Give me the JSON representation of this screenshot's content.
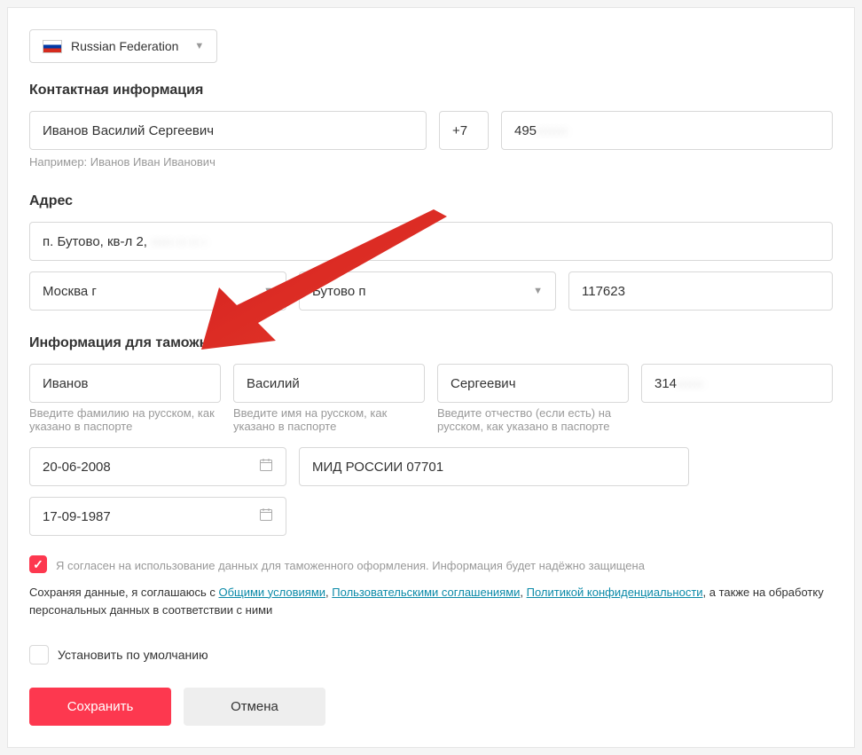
{
  "country": {
    "label": "Russian Federation"
  },
  "contact": {
    "section_title": "Контактная информация",
    "full_name": "Иванов Василий Сергеевич",
    "name_hint": "Например: Иванов Иван Иванович",
    "phone_code": "+7",
    "phone_visible": "495",
    "phone_hidden": "·······"
  },
  "address": {
    "section_title": "Адрес",
    "street_visible": "п. Бутово, кв-л 2,",
    "street_hidden": "·····  ·· ·· ·",
    "city": "Москва г",
    "district": "Бутово п",
    "zip": "117623"
  },
  "customs": {
    "section_title": "Информация для таможни",
    "last_name": "Иванов",
    "last_name_hint": "Введите фамилию на русском, как указано в паспорте",
    "first_name": "Василий",
    "first_name_hint": "Введите имя на русском, как указано в паспорте",
    "patronymic": "Сергеевич",
    "patronymic_hint": "Введите отчество (если есть) на русском, как указано в паспорте",
    "passport_prefix": "314",
    "passport_hidden": "······",
    "issue_date": "20-06-2008",
    "authority": "МИД РОССИИ 07701",
    "birth_date": "17-09-1987"
  },
  "consent": {
    "checkbox_text": "Я согласен на использование данных для таможенного оформления. Информация будет надёжно защищена",
    "terms_prefix": "Сохраняя данные, я соглашаюсь с ",
    "terms_link1": "Общими условиями",
    "terms_sep1": ", ",
    "terms_link2": "Пользовательскими соглашениями",
    "terms_sep2": ", ",
    "terms_link3": "Политикой конфиденциальности",
    "terms_suffix": ", а также на обработку персональных данных в соответствии с ними"
  },
  "default_checkbox": {
    "label": "Установить по умолчанию"
  },
  "buttons": {
    "save": "Сохранить",
    "cancel": "Отмена"
  }
}
